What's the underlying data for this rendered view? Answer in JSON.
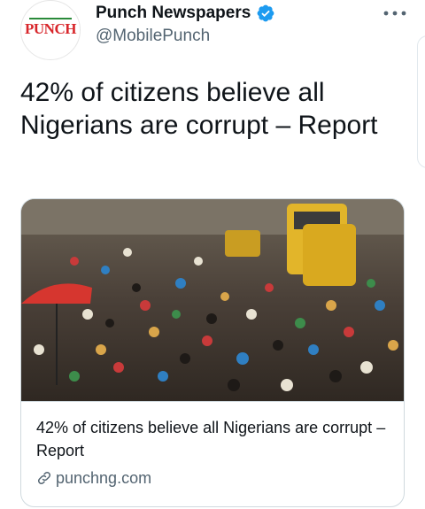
{
  "tweet": {
    "author": {
      "display_name": "Punch Newspapers",
      "handle": "@MobilePunch",
      "avatar_text": "PUNCH",
      "verified_icon": "verified-badge-icon"
    },
    "text": "42% of citizens believe all Nigerians are corrupt – Report",
    "more_icon": "more-horizontal-icon",
    "card": {
      "image_description_icon": "crowd-photo",
      "title": "42% of citizens believe all Nigerians are corrupt –Report",
      "domain": "punchng.com",
      "link_icon": "link-icon"
    }
  },
  "colors": {
    "accent": "#1d9bf0",
    "text_primary": "#0f1419",
    "text_secondary": "#536471",
    "border": "#cfd9de",
    "brand_red": "#d8262b"
  }
}
